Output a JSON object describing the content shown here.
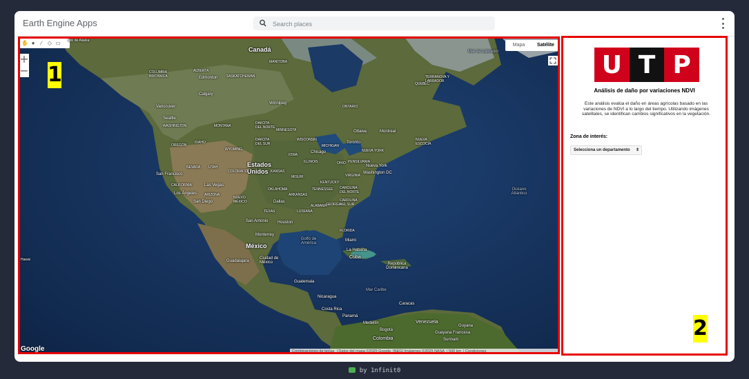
{
  "app": {
    "title": "Earth Engine Apps",
    "search_placeholder": "Search places",
    "menu_icon": "more-vert-icon"
  },
  "map": {
    "map_type_options": [
      "Mapa",
      "Satélite"
    ],
    "map_type_selected": "Satélite",
    "zoom_in": "+",
    "zoom_out": "−",
    "google_logo": "Google",
    "attribution": [
      "Combinaciones de teclas",
      "Datos del mapa ©2025 Google, INEGI Imágenes ©2025 NASA",
      "500 km",
      "Condiciones"
    ],
    "labels": {
      "alaska": "ado de Alaska",
      "canada": "Canadá",
      "mar_labrador": "Mar de Labrador",
      "columbia_britanica": "COLUMBIA BRITÁNICA",
      "alberta": "ALBERTA",
      "saskatchewan": "SASKATCHEWAN",
      "manitoba": "MANITOBA",
      "quebec": "QUEBEC",
      "terranova": "TERRANOVA Y LABRADOR",
      "ontario": "ONTARIO",
      "edmonton": "Edmonton",
      "calgary": "Calgary",
      "winnipeg": "Winnipeg",
      "vancouver": "Vancouver",
      "seattle": "Seattle",
      "washington": "WASHINGTON",
      "montana": "MONTANA",
      "dakota_norte": "DAKOTA DEL NORTE",
      "minnesota": "MINNESOTA",
      "ottawa": "Ottawa",
      "montreal": "Montreal",
      "toronto": "Toronto",
      "nueva_escocia": "NUEVA ESCOCIA",
      "michigan": "MICHIGAN",
      "oregon": "OREGÓN",
      "idaho": "IDAHO",
      "wyoming": "WYOMING",
      "dakota_sur": "DAKOTA DEL SUR",
      "wisconsin": "WISCONSIN",
      "chicago": "Chicago",
      "nueva_york": "NUEVA YORK",
      "nueva_york_city": "Nueva York",
      "washington_dc": "Washington DC",
      "estados_unidos": "Estados Unidos",
      "nevada": "NEVADA",
      "utah": "UTAH",
      "colorado": "COLORADO",
      "kansas": "KANSAS",
      "iowa": "IOWA",
      "illinois": "ILLINOIS",
      "ohio": "OHIO",
      "pensilvania": "PENSILVANIA",
      "san_francisco": "San Francisco",
      "california": "CALIFORNIA",
      "las_vegas": "Las Vegas",
      "los_angeles": "Los Ángeles",
      "arizona": "ARIZONA",
      "nuevo_mexico": "NUEVO MÉXICO",
      "oklahoma": "OKLAHOMA",
      "misuri": "MISURI",
      "kentucky": "KENTUCKY",
      "virginia": "VIRGINIA",
      "tennessee": "TENNESSEE",
      "carolina_norte": "CAROLINA DEL NORTE",
      "arkansas": "ARKANSAS",
      "carolina_sur": "CAROLINA DEL SUR",
      "san_diego": "San Diego",
      "dallas": "Dallas",
      "alabama": "ALABAMA",
      "georgia": "GEORGIA",
      "texas": "TEXAS",
      "luisiana": "LUISIANA",
      "houston": "Houston",
      "san_antonio": "San Antonio",
      "florida": "FLORIDA",
      "monterrey": "Monterrey",
      "golfo_mexico": "Golfo de América",
      "miami": "Miami",
      "mexico": "México",
      "la_habana": "La Habana",
      "cuba": "Cuba",
      "guadalajara": "Guadalajara",
      "ciudad_mexico": "Ciudad de México",
      "rep_dominicana": "República Dominicana",
      "oceano_atlantico": "Océano Atlántico",
      "hawaii": "Hawái",
      "guatemala": "Guatemala",
      "mar_caribe": "Mar Caribe",
      "nicaragua": "Nicaragua",
      "caracas": "Caracas",
      "costa_rica": "Costa Rica",
      "panama": "Panamá",
      "venezuela": "Venezuela",
      "medellin": "Medellín",
      "bogota": "Bogotá",
      "guyana": "Guyana",
      "guyana_francesa": "Guayana Francesa",
      "colombia": "Colombia",
      "surinam": "Surinam"
    }
  },
  "panel": {
    "logo_letters": [
      "U",
      "T",
      "P"
    ],
    "title": "Análisis de daño por variaciones NDVI",
    "description": "Este análisis evalúa el daño en áreas agrícolas basado en las variaciones de NDVI a lo largo del tiempo. Utilizando imágenes satelitales, se identifican cambios significativos en la vegetación.",
    "zone_label": "Zona de interés:",
    "zone_select_value": "Selecciona un departamento"
  },
  "annotations": {
    "map_number": "1",
    "panel_number": "2",
    "border_color": "#e60000",
    "label_color": "#ffff00"
  },
  "colors": {
    "utp_red": "#d0021b",
    "utp_black": "#111111",
    "page_background": "#252a3a"
  },
  "footer": {
    "text": "by 1nfinit0"
  }
}
